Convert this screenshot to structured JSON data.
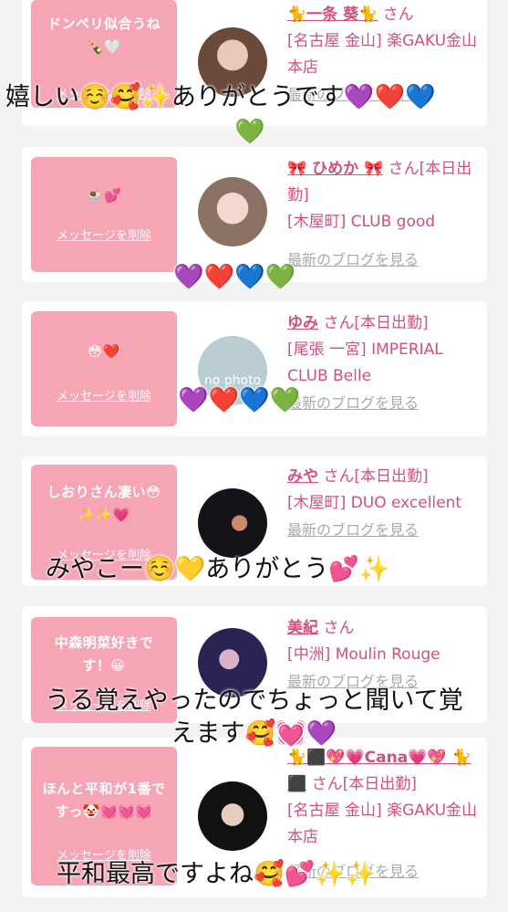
{
  "cards": [
    {
      "message": "ドンペリ似合うね 🍾🤍",
      "delete_label": "メッセージを削除",
      "name": "🐈一条 葵🐈",
      "honorific": "さん",
      "location": "[名古屋 金山] 楽GAKU金山本店",
      "blog_link": "最新のブログを見る"
    },
    {
      "message": "🍨💕",
      "delete_label": "メッセージを削除",
      "name": "🎀 ひめか 🎀",
      "honorific": "さん[本日出勤]",
      "location": "[木屋町] CLUB good",
      "blog_link": "最新のブログを見る"
    },
    {
      "message": "😳❤️",
      "delete_label": "メッセージを削除",
      "name": "ゆみ",
      "honorific": "さん[本日出勤]",
      "location": "[尾張 一宮] IMPERIAL CLUB Belle",
      "blog_link": "最新のブログを見る",
      "avatar_text": "no photo"
    },
    {
      "message": "しおりさん凄い😳 ✨✨💗",
      "delete_label": "メッセージを削除",
      "name": "みや",
      "honorific": "さん[本日出勤]",
      "location": "[木屋町] DUO excellent",
      "blog_link": "最新のブログを見る"
    },
    {
      "message": "中森明菜好きです！😀",
      "delete_label": "メッセージを削除",
      "name": "美紀",
      "honorific": "さん",
      "location": "[中洲] Moulin Rouge",
      "blog_link": "最新のブログを見る"
    },
    {
      "message": "ほんと平和が1番ですっ🤡💓💓💓",
      "delete_label": "メッセージを削除",
      "name": "🐈⬛💖💗Cana💗💖 🐈⬛",
      "honorific": "さん[本日出勤]",
      "location": "[名古屋 金山] 楽GAKU金山本店",
      "blog_link": "最新のブログを見る"
    }
  ],
  "overlays": {
    "o1": "嬉しい☺️🥰✨ありがとうです💜❤️💙",
    "o1b": "💚",
    "o2": "💜❤️💙💚",
    "o3": "💜❤️💙💚",
    "o4": "みやこー☺️💛ありがとう💕✨",
    "o5a": "うる覚えやったのでちょっと聞いて覚",
    "o5b": "えます🥰💓💜",
    "o6": "平和最高ですよね🥰💕✨✨"
  },
  "colors": {
    "accent": "#d4507a",
    "message_bg": "#f6a5b5",
    "card_bg": "#ffffff",
    "page_bg": "#f3f3f3"
  }
}
